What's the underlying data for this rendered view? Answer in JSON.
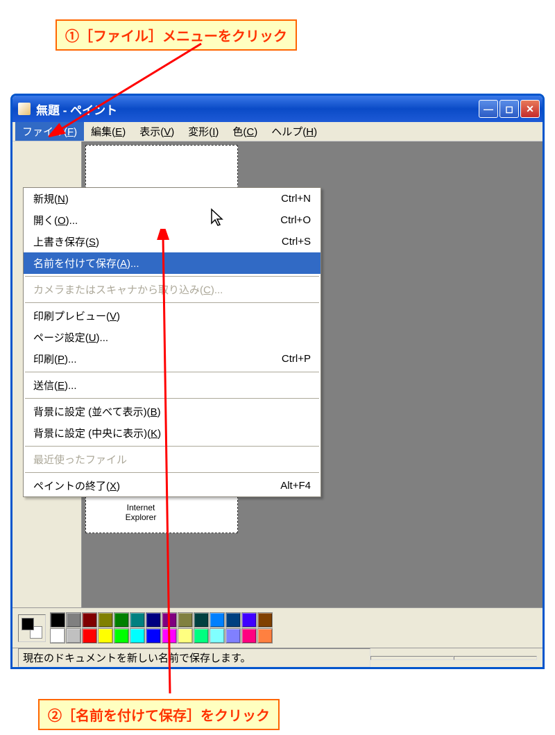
{
  "annotations": {
    "step1": "①［ファイル］メニューをクリック",
    "step2": "②［名前を付けて保存］をクリック"
  },
  "window": {
    "title": "無題 - ペイント",
    "canvas_icon_label_1": "Internet",
    "canvas_icon_label_2": "Explorer"
  },
  "menubar": [
    {
      "label": "ファイル",
      "key": "F",
      "active": true
    },
    {
      "label": "編集",
      "key": "E"
    },
    {
      "label": "表示",
      "key": "V"
    },
    {
      "label": "変形",
      "key": "I"
    },
    {
      "label": "色",
      "key": "C"
    },
    {
      "label": "ヘルプ",
      "key": "H"
    }
  ],
  "dropdown": [
    {
      "type": "item",
      "label": "新規",
      "key": "N",
      "shortcut": "Ctrl+N"
    },
    {
      "type": "item",
      "label": "開く",
      "key": "O",
      "suffix": "...",
      "shortcut": "Ctrl+O"
    },
    {
      "type": "item",
      "label": "上書き保存",
      "key": "S",
      "shortcut": "Ctrl+S"
    },
    {
      "type": "item",
      "label": "名前を付けて保存",
      "key": "A",
      "suffix": "...",
      "highlighted": true
    },
    {
      "type": "sep"
    },
    {
      "type": "item",
      "label": "カメラまたはスキャナから取り込み",
      "key": "C",
      "suffix": "...",
      "disabled": true
    },
    {
      "type": "sep"
    },
    {
      "type": "item",
      "label": "印刷プレビュー",
      "key": "V"
    },
    {
      "type": "item",
      "label": "ページ設定",
      "key": "U",
      "suffix": "..."
    },
    {
      "type": "item",
      "label": "印刷",
      "key": "P",
      "suffix": "...",
      "shortcut": "Ctrl+P"
    },
    {
      "type": "sep"
    },
    {
      "type": "item",
      "label": "送信",
      "key": "E",
      "suffix": "..."
    },
    {
      "type": "sep"
    },
    {
      "type": "item",
      "label": "背景に設定 (並べて表示)",
      "key": "B"
    },
    {
      "type": "item",
      "label": "背景に設定 (中央に表示)",
      "key": "K"
    },
    {
      "type": "sep"
    },
    {
      "type": "item",
      "label": "最近使ったファイル",
      "disabled": true
    },
    {
      "type": "sep"
    },
    {
      "type": "item",
      "label": "ペイントの終了",
      "key": "X",
      "shortcut": "Alt+F4"
    }
  ],
  "palette_row1": [
    "#000000",
    "#808080",
    "#800000",
    "#808000",
    "#008000",
    "#008080",
    "#000080",
    "#800080",
    "#808040",
    "#004040",
    "#0080ff",
    "#004080",
    "#4000ff",
    "#804000"
  ],
  "palette_row2": [
    "#ffffff",
    "#c0c0c0",
    "#ff0000",
    "#ffff00",
    "#00ff00",
    "#00ffff",
    "#0000ff",
    "#ff00ff",
    "#ffff80",
    "#00ff80",
    "#80ffff",
    "#8080ff",
    "#ff0080",
    "#ff8040"
  ],
  "statusbar": {
    "text": "現在のドキュメントを新しい名前で保存します。"
  }
}
